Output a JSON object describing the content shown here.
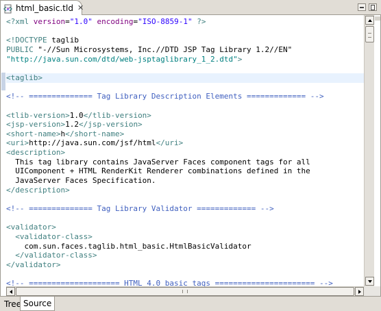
{
  "editor_tab": {
    "label": "html_basic.tld",
    "close": "✕"
  },
  "code_lines": [
    [
      {
        "c": "c-pi",
        "t": "<?xml "
      },
      {
        "c": "c-attr",
        "t": "version"
      },
      {
        "c": "c-text",
        "t": "="
      },
      {
        "c": "c-str",
        "t": "\"1.0\""
      },
      {
        "c": "c-text",
        "t": " "
      },
      {
        "c": "c-attr",
        "t": "encoding"
      },
      {
        "c": "c-text",
        "t": "="
      },
      {
        "c": "c-str",
        "t": "\"ISO-8859-1\""
      },
      {
        "c": "c-pi",
        "t": " ?>"
      }
    ],
    [],
    [
      {
        "c": "c-dt",
        "t": "<!DOCTYPE "
      },
      {
        "c": "c-text",
        "t": "taglib"
      }
    ],
    [
      {
        "c": "c-dt",
        "t": "PUBLIC "
      },
      {
        "c": "c-text",
        "t": "\"-//Sun Microsystems, Inc.//DTD JSP Tag Library 1.2//EN\""
      }
    ],
    [
      {
        "c": "c-kw",
        "t": "\"http://java.sun.com/dtd/web-jsptaglibrary_1_2.dtd\""
      },
      {
        "c": "c-dt",
        "t": ">"
      }
    ],
    [],
    [
      {
        "c": "c-tag",
        "t": "<taglib>"
      }
    ],
    [],
    [
      {
        "c": "c-cm",
        "t": "<!-- ============== Tag Library Description Elements ============= -->"
      }
    ],
    [],
    [
      {
        "c": "c-tag",
        "t": "<tlib-version>"
      },
      {
        "c": "c-text",
        "t": "1.0"
      },
      {
        "c": "c-tag",
        "t": "</tlib-version>"
      }
    ],
    [
      {
        "c": "c-tag",
        "t": "<jsp-version>"
      },
      {
        "c": "c-text",
        "t": "1.2"
      },
      {
        "c": "c-tag",
        "t": "</jsp-version>"
      }
    ],
    [
      {
        "c": "c-tag",
        "t": "<short-name>"
      },
      {
        "c": "c-text",
        "t": "h"
      },
      {
        "c": "c-tag",
        "t": "</short-name>"
      }
    ],
    [
      {
        "c": "c-tag",
        "t": "<uri>"
      },
      {
        "c": "c-text",
        "t": "http://java.sun.com/jsf/html"
      },
      {
        "c": "c-tag",
        "t": "</uri>"
      }
    ],
    [
      {
        "c": "c-tag",
        "t": "<description>"
      }
    ],
    [
      {
        "c": "c-text",
        "t": "  This tag library contains JavaServer Faces component tags for all"
      }
    ],
    [
      {
        "c": "c-text",
        "t": "  UIComponent + HTML RenderKit Renderer combinations defined in the"
      }
    ],
    [
      {
        "c": "c-text",
        "t": "  JavaServer Faces Specification."
      }
    ],
    [
      {
        "c": "c-tag",
        "t": "</description>"
      }
    ],
    [],
    [
      {
        "c": "c-cm",
        "t": "<!-- ============== Tag Library Validator ============= -->"
      }
    ],
    [],
    [
      {
        "c": "c-tag",
        "t": "<validator>"
      }
    ],
    [
      {
        "c": "c-tag",
        "t": "  <validator-class>"
      }
    ],
    [
      {
        "c": "c-text",
        "t": "    com.sun.faces.taglib.html_basic.HtmlBasicValidator"
      }
    ],
    [
      {
        "c": "c-tag",
        "t": "  </validator-class>"
      }
    ],
    [
      {
        "c": "c-tag",
        "t": "</validator>"
      }
    ],
    [],
    [
      {
        "c": "c-cm",
        "t": "<!-- ==================== HTML 4.0 basic tags ====================== -->"
      }
    ]
  ],
  "current_line_index": 6,
  "bottom_tabs": {
    "tree": "Tree",
    "source": "Source"
  },
  "colors": {
    "tag": "#3f7f7f",
    "attr": "#7f007f",
    "string": "#2a00ff",
    "comment": "#3f5fbf",
    "current_line": "#e8f2fe"
  }
}
